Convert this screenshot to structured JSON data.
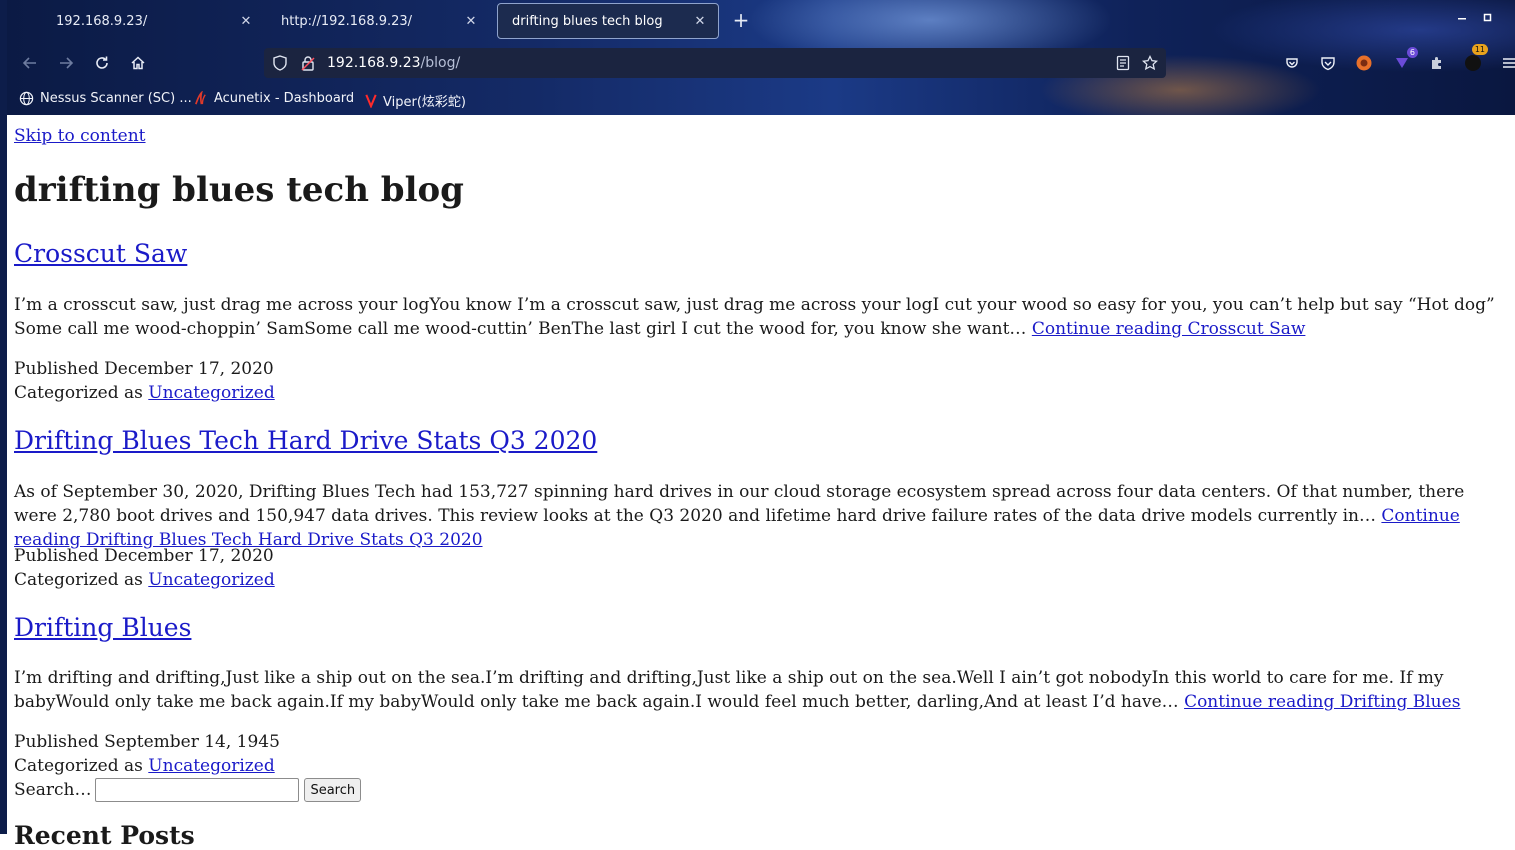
{
  "browser": {
    "tabs": [
      {
        "title": "192.168.9.23/",
        "active": false
      },
      {
        "title": "http://192.168.9.23/",
        "active": false
      },
      {
        "title": "drifting blues tech blog",
        "active": true
      }
    ],
    "close_glyph": "✕",
    "new_tab_glyph": "+",
    "url_host": "192.168.9.23",
    "url_path": "/blog/",
    "badges": {
      "extension_count": "6",
      "notification_count": "11"
    },
    "bookmarks": [
      {
        "label": "Nessus Scanner (SC) ..."
      },
      {
        "label": "Acunetix - Dashboard"
      },
      {
        "label": "Viper(炫彩蛇)"
      }
    ]
  },
  "page": {
    "skip_link": "Skip to content",
    "site_title": "drifting blues tech blog",
    "posts": [
      {
        "title": "Crosscut Saw",
        "excerpt": "I’m a crosscut saw, just drag me across your logYou know I’m a crosscut saw, just drag me across your logI cut your wood so easy for you, you can’t help but say “Hot dog” Some call me wood-choppin’ SamSome call me wood-cuttin’ BenThe last girl I cut the wood for, you know she want…",
        "continue_link": "Continue reading Crosscut Saw",
        "published": "Published December 17, 2020",
        "category_prefix": "Categorized as",
        "category": "Uncategorized"
      },
      {
        "title": "Drifting Blues Tech Hard Drive Stats Q3 2020",
        "excerpt": "As of September 30, 2020, Drifting Blues Tech had 153,727 spinning hard drives in our cloud storage ecosystem spread across four data centers. Of that number, there were 2,780 boot drives and 150,947 data drives. This review looks at the Q3 2020 and lifetime hard drive failure rates of the data drive models currently in…",
        "continue_link": "Continue reading Drifting Blues Tech Hard Drive Stats Q3 2020",
        "published": "Published December 17, 2020",
        "category_prefix": "Categorized as",
        "category": "Uncategorized"
      },
      {
        "title": "Drifting Blues",
        "excerpt": "I’m drifting and drifting,Just like a ship out on the sea.I’m drifting and drifting,Just like a ship out on the sea.Well I ain’t got nobodyIn this world to care for me. If my babyWould only take me back again.If my babyWould only take me back again.I would feel much better, darling,And at least I’d have…",
        "continue_link": "Continue reading Drifting Blues",
        "published": "Published September 14, 1945",
        "category_prefix": "Categorized as",
        "category": "Uncategorized"
      }
    ],
    "search_label": "Search…",
    "search_value": "",
    "search_button": "Search",
    "recent_heading": "Recent Posts"
  }
}
